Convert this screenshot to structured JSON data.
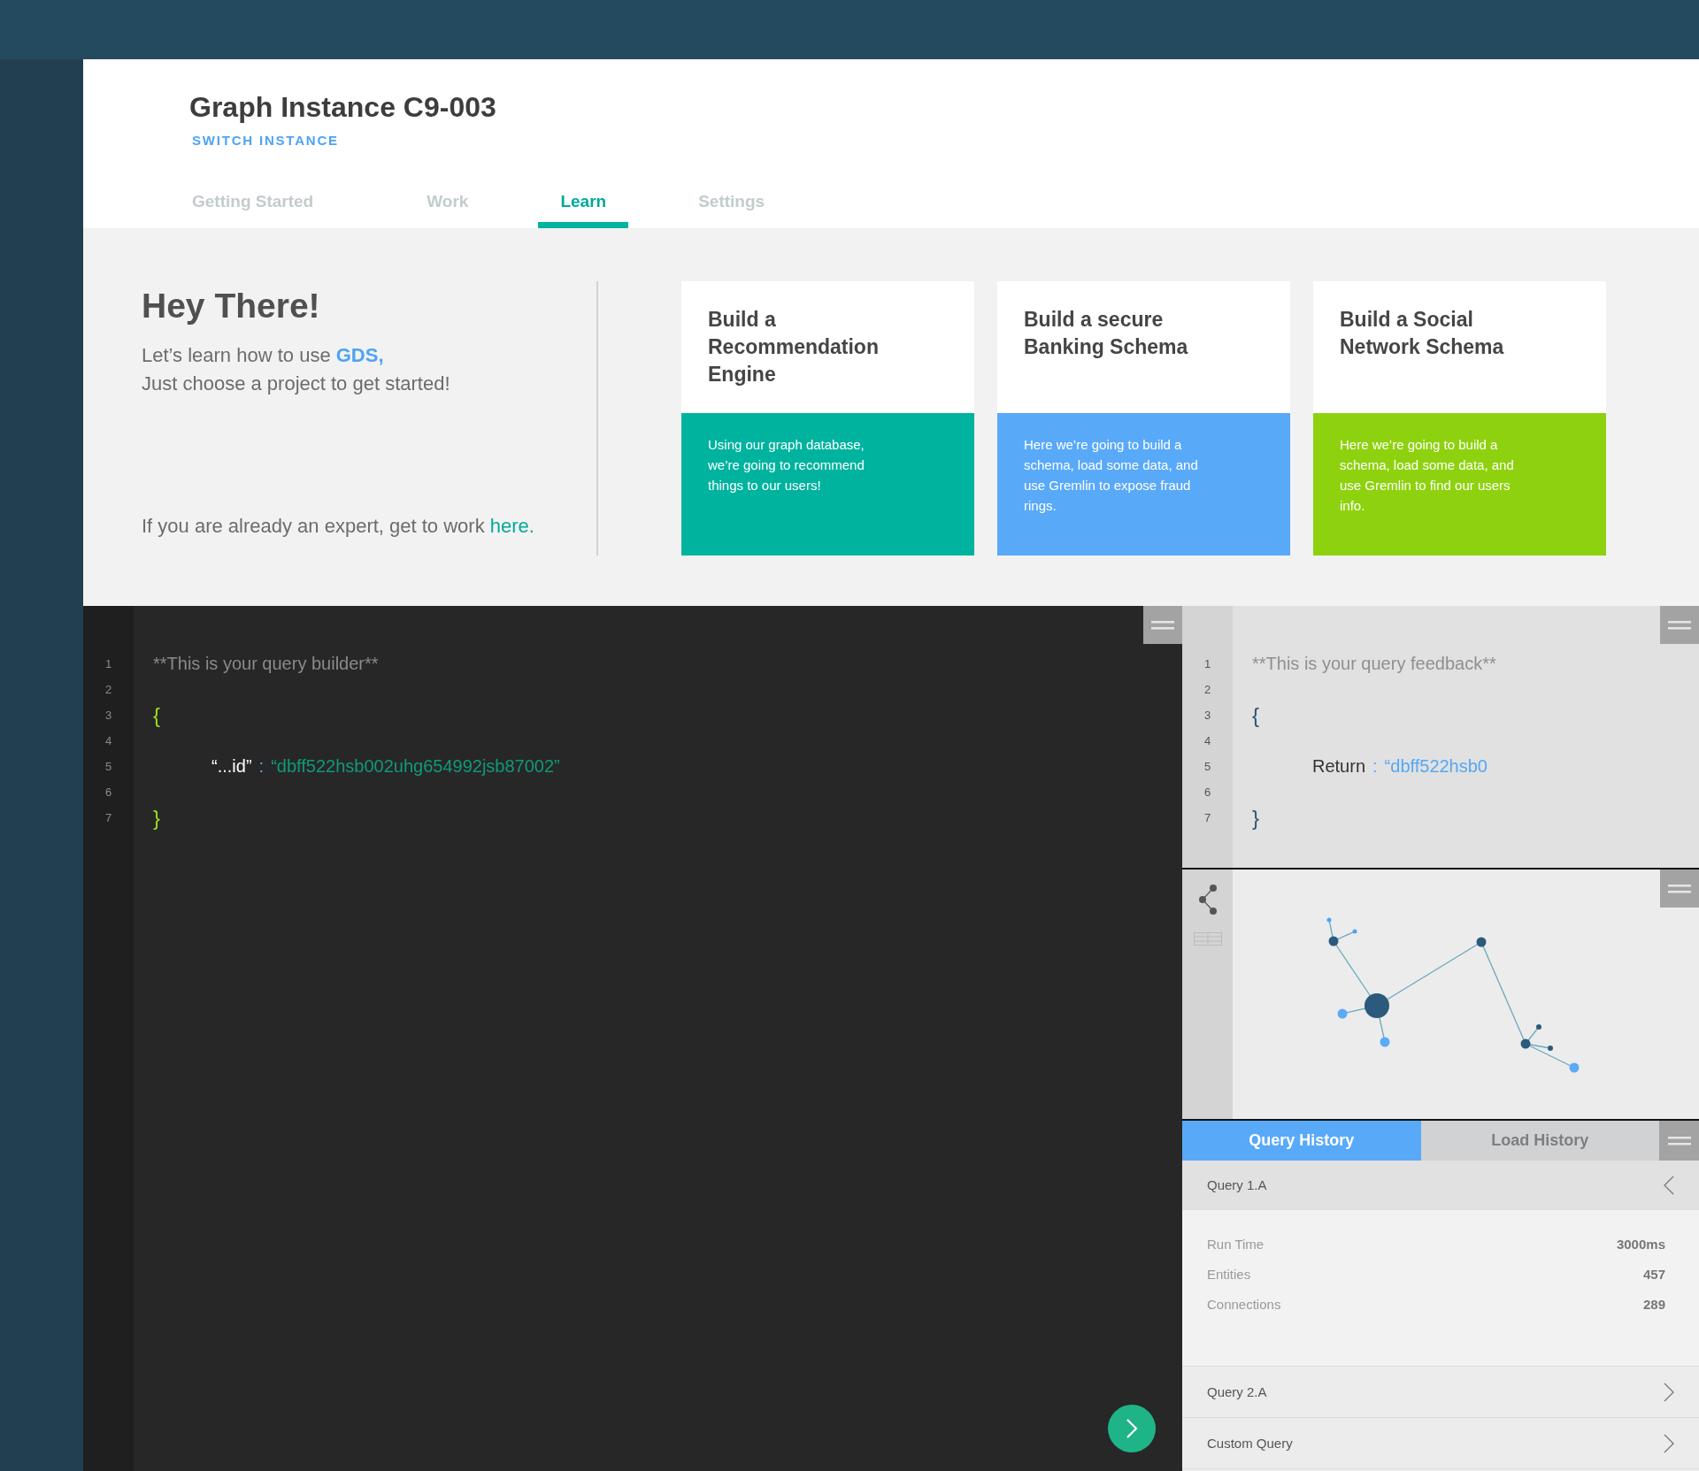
{
  "header": {
    "title": "Graph Instance C9-003",
    "switch_link": "SWITCH INSTANCE"
  },
  "tabs": [
    {
      "label": "Getting Started",
      "selected": false
    },
    {
      "label": "Work",
      "selected": false
    },
    {
      "label": "Learn",
      "selected": true
    },
    {
      "label": "Settings",
      "selected": false
    }
  ],
  "intro": {
    "heading": "Hey There!",
    "lines": [
      "Let’s learn how to use **GDS,**",
      "Just choose a project to get started!"
    ],
    "expert_text": "If you are already an expert, get to work",
    "expert_link": "here."
  },
  "cards": [
    {
      "title": "Build a Recommendation Engine",
      "description": "Using our graph database, we’re going to recommend things to our users!",
      "color": "#00b39f"
    },
    {
      "title": "Build a secure Banking Schema",
      "description": "Here we’re going to build a schema, load some data, and use Gremlin to  expose fraud rings.",
      "color": "#59a9f9"
    },
    {
      "title": "Build a Social Network Schema",
      "description": "Here we’re going to build a schema, load some data, and use Gremlin to find our users info.",
      "color": "#8ed20f"
    }
  ],
  "query_builder": {
    "lines": [
      {
        "number": "1",
        "kind": "comment",
        "text": "**This is your query builder**"
      },
      {
        "number": "2",
        "kind": "blank"
      },
      {
        "number": "3",
        "kind": "brace",
        "text": "{"
      },
      {
        "number": "4",
        "kind": "blank"
      },
      {
        "number": "5",
        "kind": "pair",
        "key": "“...id”",
        "separator": ":",
        "value": "“dbff522hsb002uhg654992jsb87002”"
      },
      {
        "number": "6",
        "kind": "blank"
      },
      {
        "number": "7",
        "kind": "brace",
        "text": "}"
      }
    ]
  },
  "query_feedback": {
    "lines": [
      {
        "number": "1",
        "kind": "comment",
        "text": "**This is your query feedback**"
      },
      {
        "number": "2",
        "kind": "blank"
      },
      {
        "number": "3",
        "kind": "brace",
        "text": "{"
      },
      {
        "number": "4",
        "kind": "blank"
      },
      {
        "number": "5",
        "kind": "pair",
        "key": "Return",
        "separator": ":",
        "value": "“dbff522hsb0"
      },
      {
        "number": "6",
        "kind": "blank"
      },
      {
        "number": "7",
        "kind": "brace",
        "text": "}"
      }
    ]
  },
  "history_tabs": [
    {
      "label": "Query History",
      "selected": true
    },
    {
      "label": "Load History",
      "selected": false
    }
  ],
  "queries": [
    {
      "name": "Query 1.A",
      "expanded": true,
      "details": [
        {
          "label": "Run Time",
          "value": "3000ms"
        },
        {
          "label": "Entities",
          "value": "457"
        },
        {
          "label": "Connections",
          "value": "289"
        }
      ]
    },
    {
      "name": "Query 2.A",
      "expanded": false
    },
    {
      "name": "Custom Query",
      "expanded": false
    }
  ]
}
